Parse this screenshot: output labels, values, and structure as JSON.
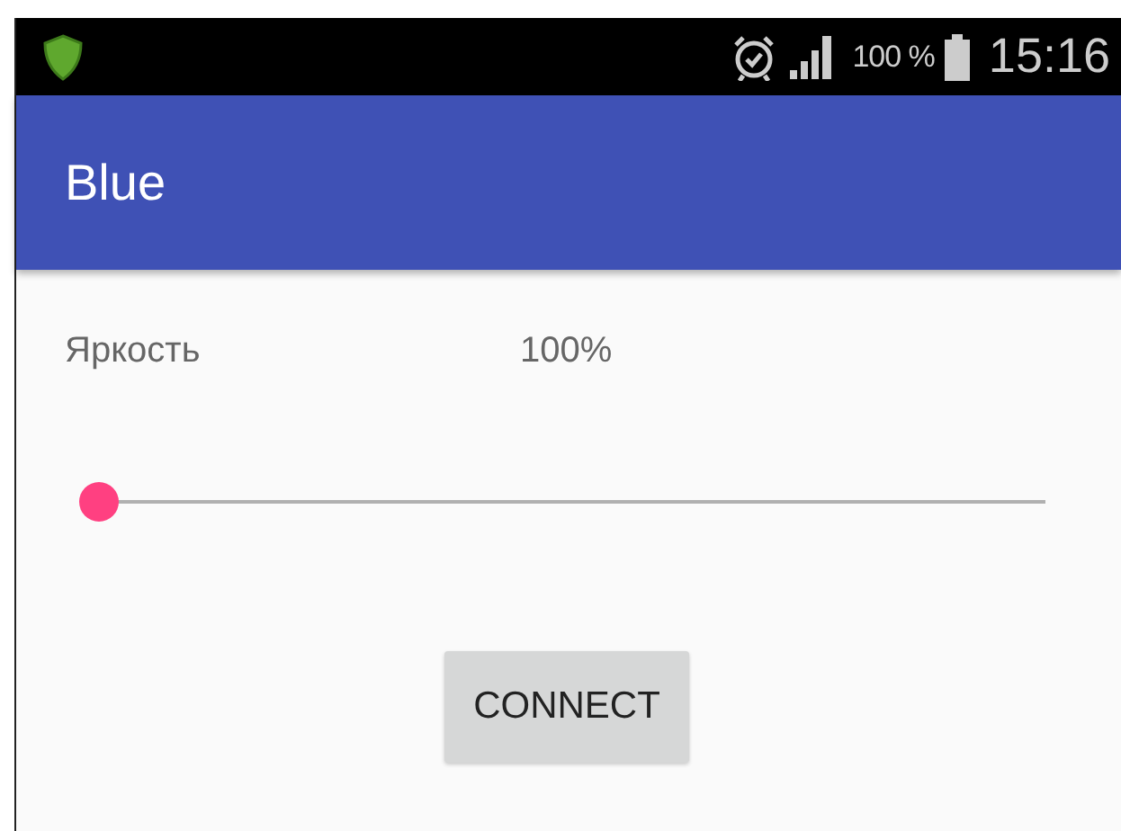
{
  "status_bar": {
    "battery_text": "100 %",
    "time": "15:16"
  },
  "app_bar": {
    "title": "Blue"
  },
  "brightness": {
    "label": "Яркость",
    "reading": "100%",
    "level": 0
  },
  "buttons": [
    {
      "label": "CONNECT"
    }
  ]
}
